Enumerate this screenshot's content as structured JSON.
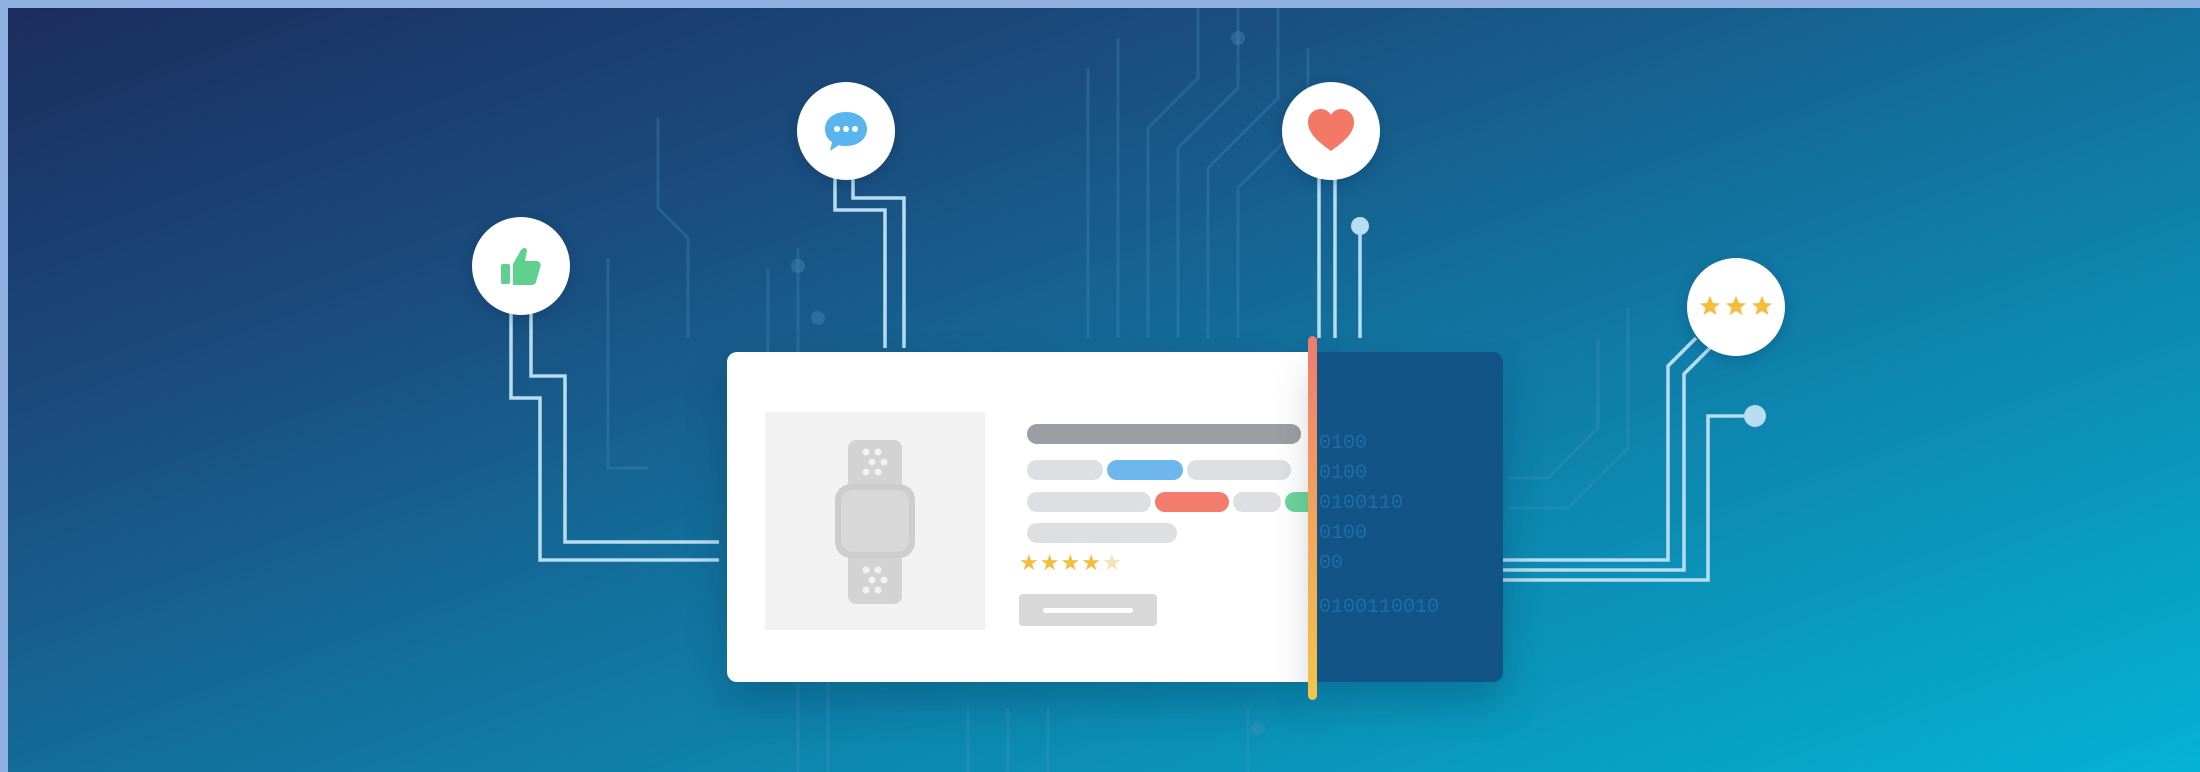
{
  "card": {
    "binary_lines": [
      "0100",
      "0100",
      "0100110",
      "0100",
      "00",
      "0100110010"
    ],
    "rating_stars": 4,
    "rating_max": 5
  },
  "icons": [
    "thumbs-up-icon",
    "chat-bubble-icon",
    "heart-icon",
    "three-stars-icon"
  ],
  "colors": {
    "card_blue_chip": "#6db6ee",
    "card_red_chip": "#f47c6a",
    "card_green_chip": "#6cd69a",
    "panel": "#135487",
    "star": "#f3bd3e"
  }
}
